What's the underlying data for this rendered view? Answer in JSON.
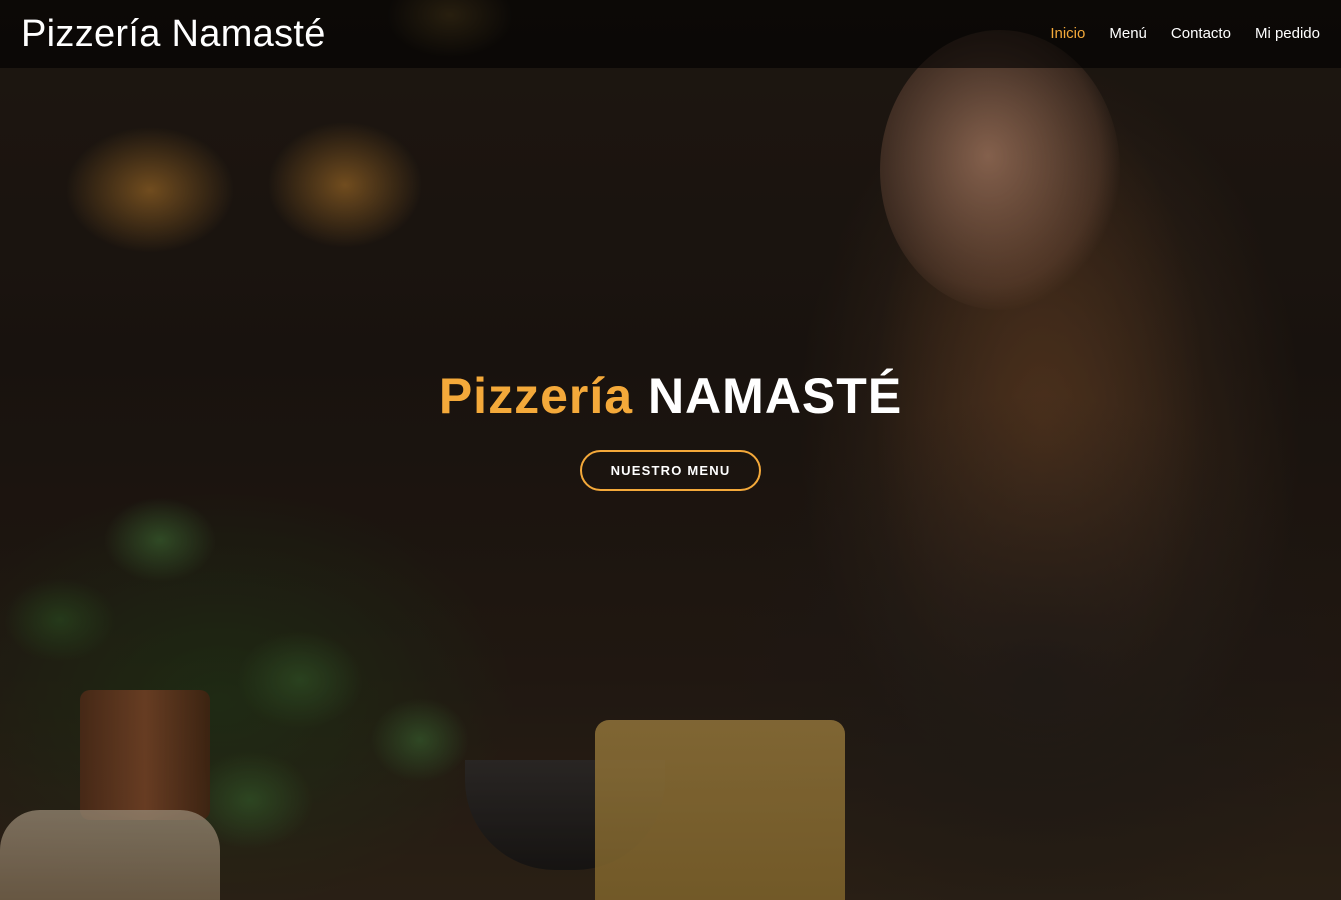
{
  "navbar": {
    "brand": "Pizzería Namasté",
    "links": [
      {
        "label": "Inicio",
        "active": true
      },
      {
        "label": "Menú",
        "active": false
      },
      {
        "label": "Contacto",
        "active": false
      },
      {
        "label": "Mi pedido",
        "active": false
      }
    ]
  },
  "hero": {
    "title_accent": "Pizzería",
    "title_main": "NAMASTÉ",
    "cta_label": "NUESTRO MENU"
  },
  "colors": {
    "accent": "#f4a93a",
    "navbar_bg": "rgba(0,0,0,0.6)",
    "text": "#ffffff"
  }
}
